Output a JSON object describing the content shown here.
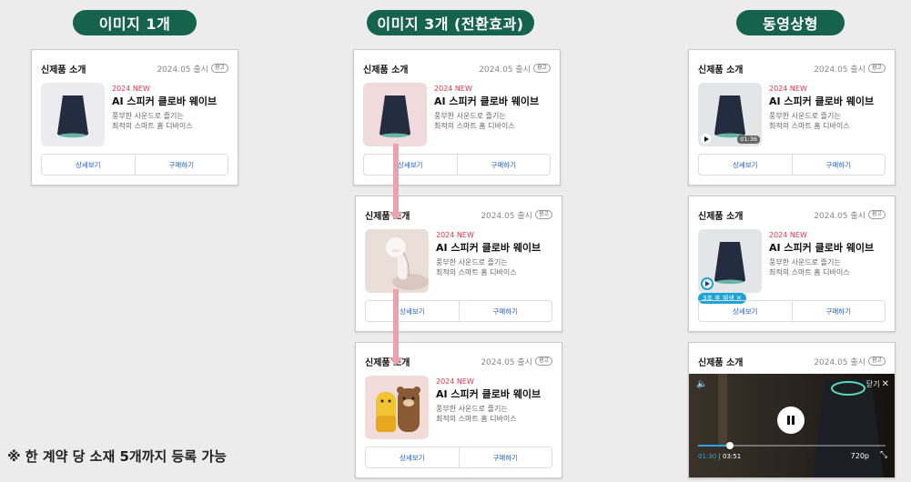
{
  "sections": {
    "single": "이미지 1개",
    "triple": "이미지 3개 (전환효과)",
    "video": "동영상형"
  },
  "card": {
    "title": "신제품 소개",
    "date": "2024.05 출시",
    "ad_badge": "광고",
    "new_label": "2024 NEW",
    "product_name": "AI 스피커 클로바 웨이브",
    "desc_line1": "풍부한 사운드로 즐기는",
    "desc_line2": "최적의 스마트 홈 디바이스",
    "detail_button": "상세보기",
    "buy_button": "구매하기"
  },
  "video": {
    "duration_badge": "01:36",
    "autoplay_label": "3초 후 재생 ✕",
    "close_label": "닫기",
    "current_time": "01:30",
    "total_time": "03:51",
    "quality": "720p",
    "progress": 0.17
  },
  "note": "※ 한 계약 당 소재 5개까지 등록 가능",
  "colors": {
    "pill": "#14634a",
    "new": "#e2364c",
    "button_text": "#1e5ad6",
    "arrow": "#eaa2ae",
    "autoplay": "#1fa3d6"
  }
}
